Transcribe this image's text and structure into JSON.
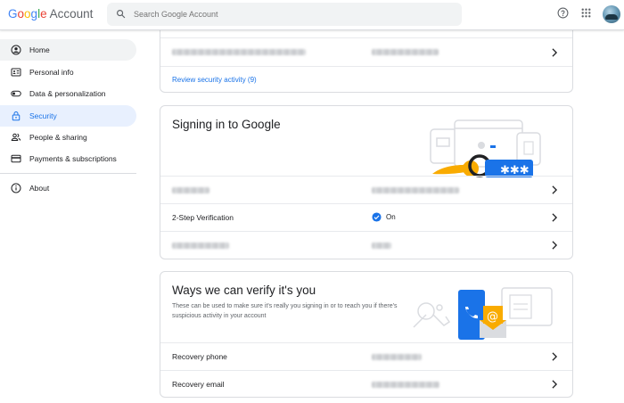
{
  "header": {
    "logo_google": "Google",
    "logo_account": "Account",
    "search_placeholder": "Search Google Account",
    "logo_colors": [
      "#4285F4",
      "#EA4335",
      "#FBBC05",
      "#4285F4",
      "#34A853",
      "#EA4335"
    ]
  },
  "sidebar": {
    "items": [
      {
        "label": "Home",
        "icon": "person-circle-icon"
      },
      {
        "label": "Personal info",
        "icon": "id-card-icon"
      },
      {
        "label": "Data & personalization",
        "icon": "toggle-icon"
      },
      {
        "label": "Security",
        "icon": "lock-icon"
      },
      {
        "label": "People & sharing",
        "icon": "people-icon"
      },
      {
        "label": "Payments & subscriptions",
        "icon": "credit-card-icon"
      }
    ],
    "about": {
      "label": "About",
      "icon": "info-icon"
    }
  },
  "security_activity": {
    "review_link": "Review security activity (9)"
  },
  "signing_in": {
    "title": "Signing in to Google",
    "two_step": {
      "label": "2-Step Verification",
      "status": "On"
    }
  },
  "verify": {
    "title": "Ways we can verify it's you",
    "description": "These can be used to make sure it's really you signing in or to reach you if there's suspicious activity in your account",
    "recovery_phone": {
      "label": "Recovery phone"
    },
    "recovery_email": {
      "label": "Recovery email"
    }
  },
  "colors": {
    "accent": "#1a73e8",
    "active_bg": "#e8f0fe"
  }
}
